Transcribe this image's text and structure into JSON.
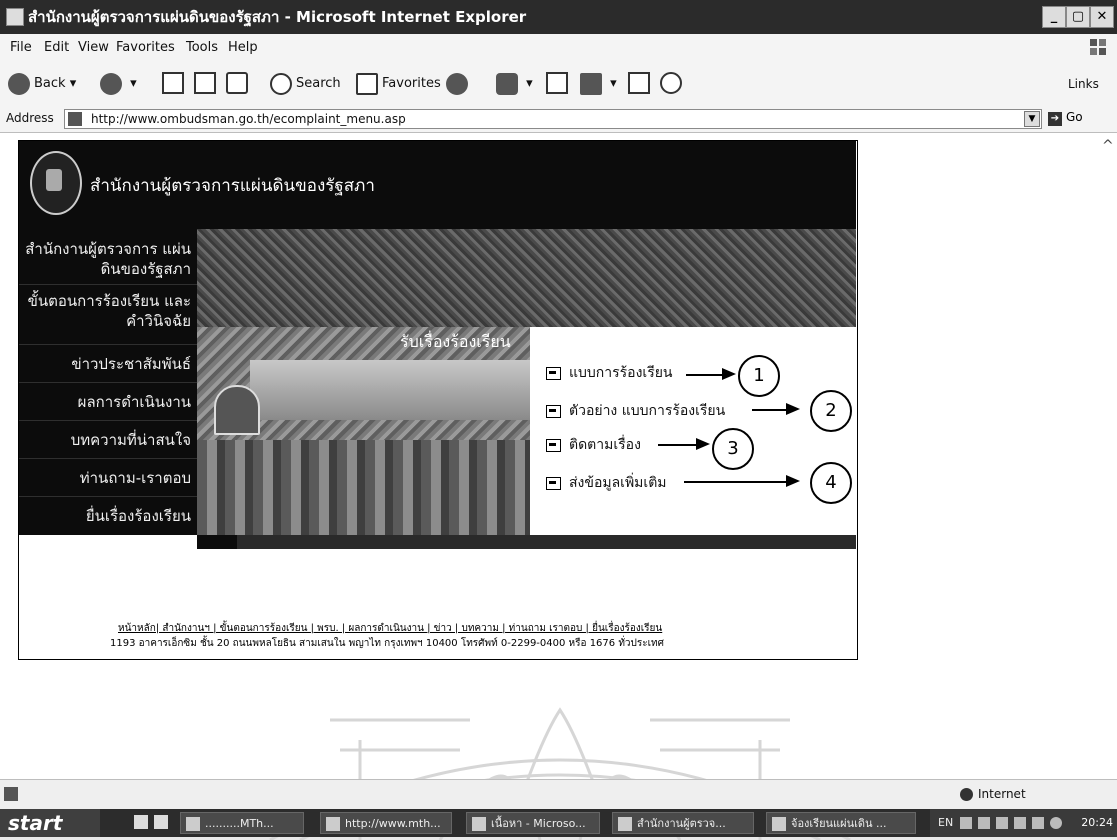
{
  "window": {
    "title": "สำนักงานผู้ตรวจการแผ่นดินของรัฐสภา - Microsoft Internet Explorer",
    "minimize": "_",
    "maximize": "▢",
    "close": "✕"
  },
  "menubar": [
    "File",
    "Edit",
    "View",
    "Favorites",
    "Tools",
    "Help"
  ],
  "toolbar": {
    "back": "Back",
    "search": "Search",
    "favorites": "Favorites",
    "links": "Links"
  },
  "address": {
    "label": "Address",
    "url": "http://www.ombudsman.go.th/ecomplaint_menu.asp",
    "go": "Go"
  },
  "site": {
    "title": "สำนักงานผู้ตรวจการแผ่นดินของรัฐสภา",
    "nav": [
      "สำนักงานผู้ตรวจการ แผ่นดินของรัฐสภา",
      "ขั้นตอนการร้องเรียน และคำวินิจฉัย",
      "ข่าวประชาสัมพันธ์",
      "ผลการดำเนินงาน",
      "บทความที่น่าสนใจ",
      "ท่านถาม-เราตอบ",
      "ยื่นเรื่องร้องเรียน"
    ],
    "section_caption": "รับเรื่องร้องเรียน",
    "menu": [
      {
        "label": "แบบการร้องเรียน",
        "num": "1"
      },
      {
        "label": "ตัวอย่าง แบบการร้องเรียน",
        "num": "2"
      },
      {
        "label": "ติดตามเรื่อง",
        "num": "3"
      },
      {
        "label": "ส่งข้อมูลเพิ่มเติม",
        "num": "4"
      }
    ],
    "footer_links": "หน้าหลัก| สำนักงานฯ | ขั้นตอนการร้องเรียน | พรบ. | ผลการดำเนินงาน | ข่าว | บทความ | ท่านถาม เราตอบ | ยื่นเรื่องร้องเรียน",
    "footer_address": "1193 อาคารเอ็กซิม ชั้น 20 ถนนพหลโยธิน สามเสนใน พญาไท กรุงเทพฯ 10400 โทรศัพท์ 0-2299-0400 หรือ 1676 ทั่วประเทศ"
  },
  "status": {
    "zone": "Internet"
  },
  "taskbar": {
    "start": "start",
    "tasks": [
      "..........MTh...",
      "http://www.mth...",
      "เนื้อหา - Microso...",
      "สำนักงานผู้ตรวจ...",
      "จ้องเรียนแผ่นเดิน ..."
    ],
    "lang": "EN",
    "time": "20:24"
  }
}
